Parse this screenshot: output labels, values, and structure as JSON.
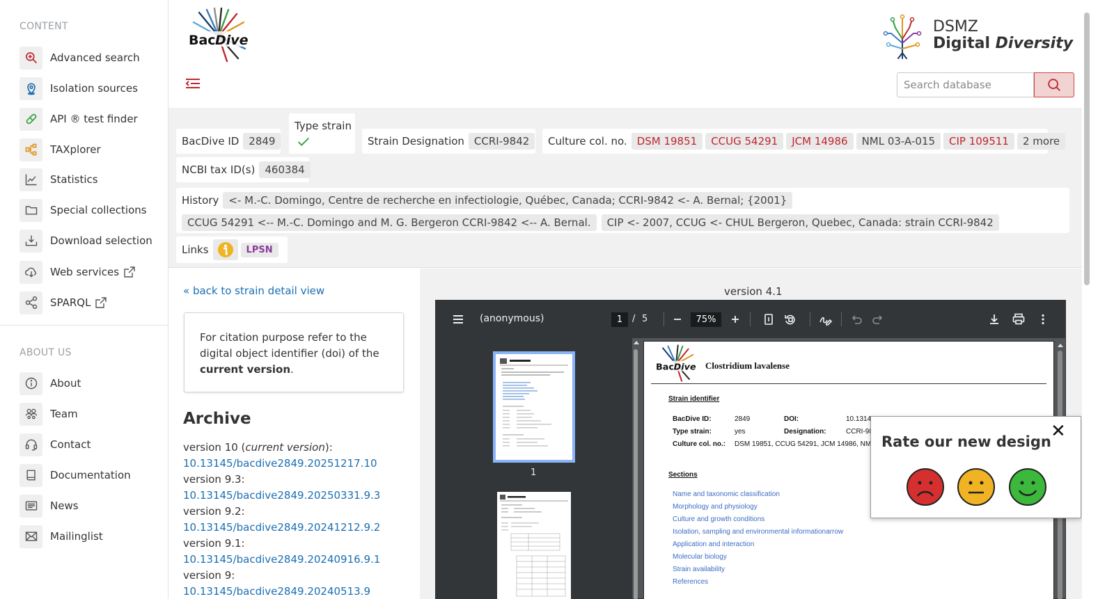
{
  "sidebar": {
    "content_title": "CONTENT",
    "about_title": "ABOUT US",
    "content_items": [
      {
        "label": "Advanced search",
        "icon": "zoom-in-icon"
      },
      {
        "label": "Isolation sources",
        "icon": "map-pin-icon"
      },
      {
        "label": "API ® test finder",
        "icon": "pill-icon"
      },
      {
        "label": "TAXplorer",
        "icon": "tree-icon"
      },
      {
        "label": "Statistics",
        "icon": "chart-line-icon"
      },
      {
        "label": "Special collections",
        "icon": "folder-icon"
      },
      {
        "label": "Download selection",
        "icon": "download-tray-icon"
      },
      {
        "label": "Web services",
        "icon": "cloud-download-icon"
      },
      {
        "label": "SPARQL",
        "icon": "share-nodes-icon"
      }
    ],
    "about_items": [
      {
        "label": "About",
        "icon": "info-circle-icon"
      },
      {
        "label": "Team",
        "icon": "team-icon"
      },
      {
        "label": "Contact",
        "icon": "headset-icon"
      },
      {
        "label": "Documentation",
        "icon": "book-icon"
      },
      {
        "label": "News",
        "icon": "newspaper-icon"
      },
      {
        "label": "Mailinglist",
        "icon": "envelope-icon"
      }
    ]
  },
  "header": {
    "logo_text": "BacDive",
    "dsmz_line1": "DSMZ",
    "dsmz_line2a": "Digital",
    "dsmz_line2b": "Diversity",
    "search_placeholder": "Search database"
  },
  "strain": {
    "bacdive_id_label": "BacDive ID",
    "bacdive_id": "2849",
    "type_strain_label": "Type strain",
    "strain_designation_label": "Strain Designation",
    "strain_designation": "CCRI-9842",
    "culture_label": "Culture col. no.",
    "culture_numbers": [
      {
        "text": "DSM 19851",
        "linked": true
      },
      {
        "text": "CCUG 54291",
        "linked": true
      },
      {
        "text": "JCM 14986",
        "linked": true
      },
      {
        "text": "NML 03-A-015",
        "linked": false
      },
      {
        "text": "CIP 109511",
        "linked": true
      },
      {
        "text": "2 more",
        "linked": false
      }
    ],
    "ncbi_label": "NCBI tax ID(s)",
    "ncbi_id": "460384",
    "history_label": "History",
    "history": [
      "<- M.-C. Domingo, Centre de recherche en infectiologie, Québec, Canada; CCRI-9842 <- A. Bernal; {2001}",
      "CCUG 54291 <-- M.-C. Domingo and M. G. Bergeron CCRI-9842 <-- A. Bernal.",
      "CIP <- 2007, CCUG <- CHUL Bergeron, Quebec, Canada: strain CCRI-9842"
    ],
    "links_label": "Links",
    "lpsn_label": "LPSN"
  },
  "archive": {
    "back_link": "« back to strain detail view",
    "citation_part1": "For citation purpose refer to the digital object identifier (doi) of the ",
    "citation_bold": "current version",
    "citation_end": ".",
    "heading": "Archive",
    "versions": [
      {
        "label": "version 10 (",
        "note": "current version",
        "label_end": "):",
        "doi": "10.13145/bacdive2849.20251217.10"
      },
      {
        "label": "version 9.3:",
        "note": "",
        "label_end": "",
        "doi": "10.13145/bacdive2849.20250331.9.3"
      },
      {
        "label": "version 9.2:",
        "note": "",
        "label_end": "",
        "doi": "10.13145/bacdive2849.20241212.9.2"
      },
      {
        "label": "version 9.1:",
        "note": "",
        "label_end": "",
        "doi": "10.13145/bacdive2849.20240916.9.1"
      },
      {
        "label": "version 9:",
        "note": "",
        "label_end": "",
        "doi": "10.13145/bacdive2849.20240513.9"
      }
    ]
  },
  "viewer": {
    "version_title": "version 4.1",
    "doc_name": "(anonymous)",
    "current_page": "1",
    "page_separator": "/",
    "total_pages": "5",
    "zoom": "75%",
    "thumb_label": "1",
    "page": {
      "title": "Clostridium lavalense",
      "strain_identifier_heading": "Strain identifier",
      "bacdive_id_label": "BacDive ID:",
      "bacdive_id": "2849",
      "doi_label": "DOI:",
      "doi_value": "10.1314",
      "type_strain_label": "Type strain:",
      "type_strain": "yes",
      "designation_label": "Designation:",
      "designation": "CCRI-98",
      "culture_label": "Culture col. no.:",
      "culture": "DSM 19851, CCUG 54291, JCM 14986, NML",
      "sections_heading": "Sections",
      "sections": [
        "Name and taxonomic classification",
        "Morphology and physiology",
        "Culture and growth conditions",
        "Isolation, sampling and environmental informationarrow",
        "Application and interaction",
        "Molecular biology",
        "Strain availability",
        "References"
      ]
    }
  },
  "rate": {
    "title": "Rate our new design",
    "close": "✕",
    "faces": [
      "sad-face-icon",
      "neutral-face-icon",
      "happy-face-icon"
    ]
  },
  "colors": {
    "accent_red": "#c0262d",
    "link_blue": "#1a6fb3",
    "toolbar": "#323639"
  }
}
